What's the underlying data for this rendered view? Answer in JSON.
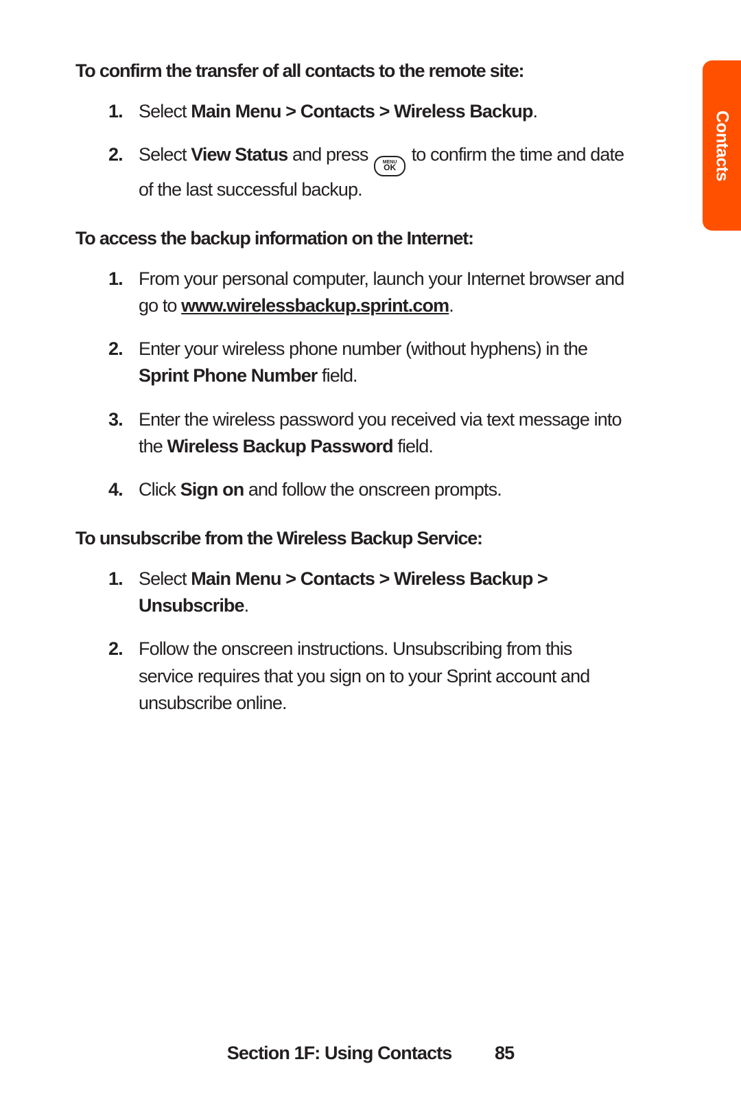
{
  "tab": {
    "label": "Contacts"
  },
  "sections": [
    {
      "heading": "To confirm the transfer of all contacts to the remote site:",
      "items": [
        {
          "num": "1.",
          "runs": [
            {
              "t": "Select "
            },
            {
              "t": "Main Menu > Contacts > Wireless Backup",
              "b": true
            },
            {
              "t": "."
            }
          ]
        },
        {
          "num": "2.",
          "runs": [
            {
              "t": "Select "
            },
            {
              "t": "View Status",
              "b": true
            },
            {
              "t": " and press "
            },
            {
              "key": true,
              "top": "MENU",
              "bot": "OK"
            },
            {
              "t": " to confirm the time and date of the last successful backup."
            }
          ]
        }
      ]
    },
    {
      "heading": "To access the backup information on the Internet:",
      "items": [
        {
          "num": "1.",
          "runs": [
            {
              "t": " From your personal computer, launch your Internet browser and go to "
            },
            {
              "t": "www.wirelessbackup.sprint.com",
              "b": true,
              "u": true
            },
            {
              "t": "."
            }
          ]
        },
        {
          "num": "2.",
          "runs": [
            {
              "t": "Enter your wireless phone number (without hyphens) in the "
            },
            {
              "t": "Sprint Phone Number",
              "b": true
            },
            {
              "t": " field."
            }
          ]
        },
        {
          "num": "3.",
          "runs": [
            {
              "t": "Enter the wireless password you received via text message into the "
            },
            {
              "t": "Wireless Backup Password",
              "b": true
            },
            {
              "t": " field."
            }
          ]
        },
        {
          "num": "4.",
          "runs": [
            {
              "t": "Click "
            },
            {
              "t": "Sign on",
              "b": true
            },
            {
              "t": " and follow the onscreen prompts."
            }
          ]
        }
      ]
    },
    {
      "heading": "To unsubscribe from the Wireless Backup Service:",
      "items": [
        {
          "num": "1.",
          "runs": [
            {
              "t": "Select "
            },
            {
              "t": "Main Menu > Contacts > Wireless Backup > Unsubscribe",
              "b": true
            },
            {
              "t": "."
            }
          ]
        },
        {
          "num": "2.",
          "runs": [
            {
              "t": "Follow the onscreen instructions. Unsubscribing from this service requires that you sign on to your Sprint account and unsubscribe online."
            }
          ]
        }
      ]
    }
  ],
  "footer": {
    "section": "Section 1F: Using Contacts",
    "page": "85"
  }
}
